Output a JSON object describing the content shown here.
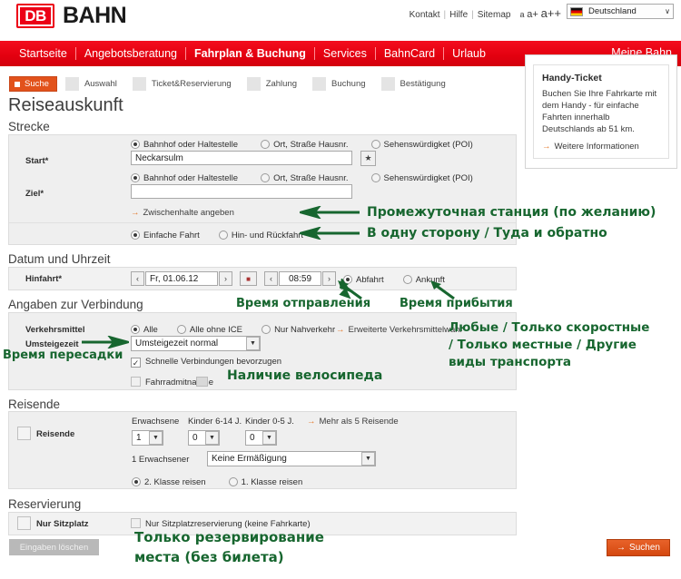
{
  "brand": {
    "logo_text": "DB",
    "name": "BAHN"
  },
  "topbar": {
    "links": [
      "Kontakt",
      "Hilfe",
      "Sitemap"
    ],
    "font_sizes": [
      "a",
      "a+",
      "a++"
    ],
    "country": "Deutschland",
    "country_icon": "flag-germany-icon",
    "chevron": "∨"
  },
  "nav": {
    "items": [
      "Startseite",
      "Angebotsberatung",
      "Fahrplan & Buchung",
      "Services",
      "BahnCard",
      "Urlaub"
    ],
    "active": "Fahrplan & Buchung",
    "right_item": "Meine Bahn"
  },
  "steps": [
    {
      "label": "Suche",
      "active": true
    },
    {
      "label": "Auswahl",
      "active": false
    },
    {
      "label": "Ticket&Reservierung",
      "active": false
    },
    {
      "label": "Zahlung",
      "active": false
    },
    {
      "label": "Buchung",
      "active": false
    },
    {
      "label": "Bestätigung",
      "active": false
    }
  ],
  "page_title": "Reiseauskunft",
  "sections": {
    "strecke": "Strecke",
    "datum": "Datum und Uhrzeit",
    "angaben": "Angaben zur Verbindung",
    "reisende": "Reisende",
    "reservierung": "Reservierung"
  },
  "strecke": {
    "start_label": "Start*",
    "ziel_label": "Ziel*",
    "start_value": "Neckarsulm",
    "ziel_value": "",
    "radio_options": [
      "Bahnhof oder Haltestelle",
      "Ort, Straße Hausnr.",
      "Sehenswürdigket (POI)"
    ],
    "start_selected": "Bahnhof oder Haltestelle",
    "ziel_selected": "Bahnhof oder Haltestelle",
    "favorite_icon": "star-icon",
    "zwischenhalte_link": "Zwischenhalte angeben",
    "trip_type_options": [
      "Einfache Fahrt",
      "Hin- und Rückfahrt"
    ],
    "trip_type_selected": "Einfache Fahrt"
  },
  "datum": {
    "hinfahrt_label": "Hinfahrt*",
    "date_value": "Fr, 01.06.12",
    "time_value": "08:59",
    "calendar_icon": "calendar-icon",
    "prev_icon": "‹",
    "next_icon": "›",
    "time_mode_options": [
      "Abfahrt",
      "Ankunft"
    ],
    "time_mode_selected": "Abfahrt"
  },
  "angaben": {
    "verkehrsmittel_label": "Verkehrsmittel",
    "umsteigezeit_label": "Umsteigezeit",
    "verkehrsmittel_options": [
      "Alle",
      "Alle ohne ICE",
      "Nur Nahverkehr"
    ],
    "verkehrsmittel_selected": "Alle",
    "erweiterte_link": "Erweiterte Verkehrsmittelwahl",
    "umsteigezeit_value": "Umsteigezeit normal",
    "schnelle_label": "Schnelle Verbindungen bevorzugen",
    "schnelle_checked": true,
    "fahrrad_label": "Fahrradmitnahme",
    "fahrrad_checked": false,
    "bike_icon": "bicycle-icon",
    "check_glyph": "✓"
  },
  "reisende": {
    "row_label": "Reisende",
    "row_icon": "passenger-icon",
    "col_erwachsene": "Erwachsene",
    "col_kinder614": "Kinder 6-14 J.",
    "col_kinder05": "Kinder 0-5 J.",
    "mehr_link": "Mehr als 5 Reisende",
    "erwachsene_value": "1",
    "kinder614_value": "0",
    "kinder05_value": "0",
    "ermaessigung_label": "1 Erwachsener",
    "ermaessigung_value": "Keine Ermäßigung",
    "klasse_options": [
      "2. Klasse reisen",
      "1. Klasse reisen"
    ],
    "klasse_selected": "2. Klasse reisen"
  },
  "reservierung": {
    "row_label": "Nur Sitzplatz",
    "row_icon": "seat-icon",
    "checkbox_label": "Nur Sitzplatzreservierung (keine Fahrkarte)",
    "checked": false
  },
  "handy_ticket": {
    "title": "Handy-Ticket",
    "body": "Buchen Sie Ihre Fahrkarte mit dem Handy - für einfache Fahrten innerhalb Deutschlands ab 51 km.",
    "link": "Weitere Informationen"
  },
  "buttons": {
    "clear": "Eingaben löschen",
    "search": "Suchen",
    "search_arrow": "→"
  },
  "annotations": {
    "zwischenhalte": "Промежуточная станция (по желанию)",
    "richtung": "В одну сторону / Туда и обратно",
    "abfahrt": "Время отправления",
    "ankunft": "Время прибытия",
    "umsteigezeit": "Время пересадки",
    "verkehrsmittel_l1": "Любые / Только скоростные",
    "verkehrsmittel_l2": "/ Только местные / Другие",
    "verkehrsmittel_l3": "виды транспорта",
    "fahrrad": "Наличие велосипеда",
    "reservierung_l1": "Только резервирование",
    "reservierung_l2": "места (без билета)"
  },
  "colors": {
    "db_red": "#e3000f",
    "accent_orange": "#e2521b",
    "annotation_green": "#17662f",
    "panel_gray": "#efefef"
  }
}
